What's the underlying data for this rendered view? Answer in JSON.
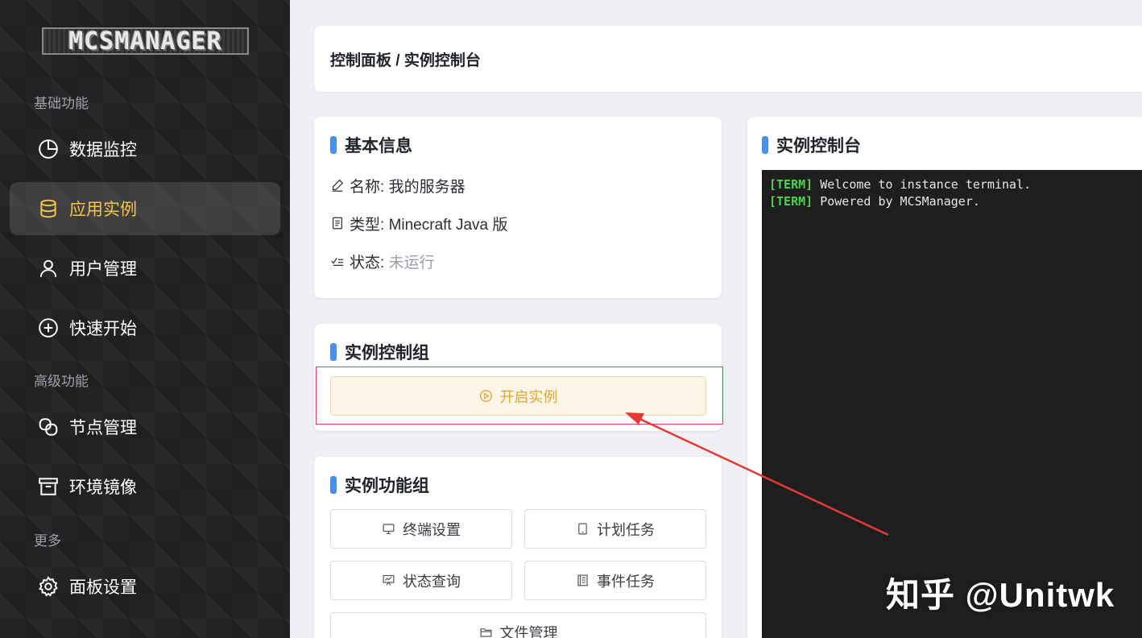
{
  "sidebar": {
    "logo": "MCSMANAGER",
    "sections": {
      "basic": "基础功能",
      "advanced": "高级功能",
      "more": "更多"
    },
    "items": [
      {
        "label": "数据监控",
        "icon": "pie-chart-icon",
        "active": false
      },
      {
        "label": "应用实例",
        "icon": "database-icon",
        "active": true
      },
      {
        "label": "用户管理",
        "icon": "user-icon",
        "active": false
      },
      {
        "label": "快速开始",
        "icon": "plus-circle-icon",
        "active": false
      },
      {
        "label": "节点管理",
        "icon": "node-link-icon",
        "active": false
      },
      {
        "label": "环境镜像",
        "icon": "archive-box-icon",
        "active": false
      },
      {
        "label": "面板设置",
        "icon": "gear-icon",
        "active": false
      }
    ],
    "active_color": "#f7c548"
  },
  "header": {
    "breadcrumb": "控制面板 / 实例控制台"
  },
  "basic_info": {
    "title": "基本信息",
    "name_label": "名称:",
    "name_value": "我的服务器",
    "type_label": "类型:",
    "type_value": "Minecraft Java 版",
    "status_label": "状态:",
    "status_value": "未运行"
  },
  "control_group": {
    "title": "实例控制组",
    "start_button": "开启实例"
  },
  "function_group": {
    "title": "实例功能组",
    "buttons": [
      {
        "label": "终端设置",
        "icon": "monitor-icon"
      },
      {
        "label": "计划任务",
        "icon": "tablet-icon"
      },
      {
        "label": "状态查询",
        "icon": "chart-board-icon"
      },
      {
        "label": "事件任务",
        "icon": "document-list-icon"
      },
      {
        "label": "文件管理",
        "icon": "folder-icon"
      }
    ]
  },
  "console": {
    "title": "实例控制台",
    "lines": [
      {
        "tag": "[TERM]",
        "text": " Welcome to instance terminal."
      },
      {
        "tag": "[TERM]",
        "text": " Powered by MCSManager."
      }
    ]
  },
  "watermark": "知乎 @Unitwk",
  "colors": {
    "accent_bar": "#4a8ff0",
    "highlight": "#e0424a",
    "terminal_tag": "#4ed34e"
  }
}
